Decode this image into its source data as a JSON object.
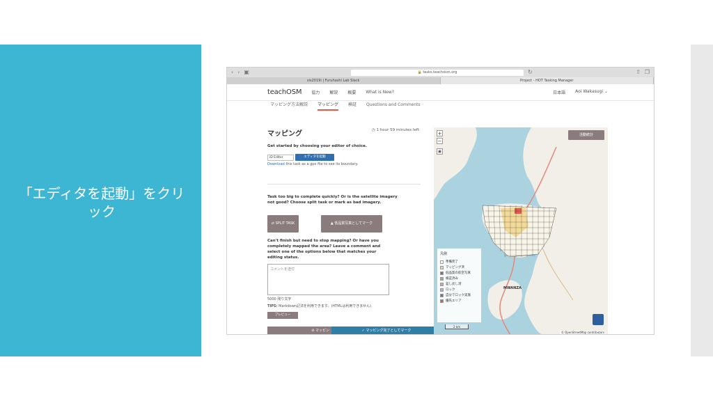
{
  "slide": {
    "caption": "「エディタを起動」をクリック",
    "colors": {
      "panel": "#3db6d4",
      "strip": "#e9e9e9"
    }
  },
  "browser": {
    "url": "tasks.teachosm.org",
    "tabs": [
      "sis2019i | Furuhashi Lab Slack",
      "Project - HOT Tasking Manager"
    ]
  },
  "app": {
    "logo": "teachOSM",
    "nav": [
      "協力",
      "解説",
      "概要",
      "What is New?"
    ],
    "language": "日本語",
    "user": "Aoi Wakasugi",
    "subnav": [
      "マッピング方法解説",
      "マッピング",
      "検証",
      "Questions and Comments"
    ],
    "active_subnav": "マッピング"
  },
  "panel": {
    "title": "マッピング",
    "timer": "1 hour 59 minutes left",
    "intro": "Get started by choosing your editor of choice.",
    "editor_select": "iD Editor",
    "launch_button": "エディタを起動",
    "download_link": "Download",
    "download_text": " this task as a gpx file to see its boundary.",
    "split_question": "Task too big to complete quickly? Or is the satellite imagery not good? Choose split task or mark as bad imagery.",
    "split_button": "SPLIT TASK",
    "bad_imagery_button": "低品質写真としてマーク",
    "stop_question": "Can't finish but need to stop mapping? Or have you completely mapped the area? Leave a comment and select one of the options below that matches your editing status.",
    "comment_placeholder": "コメントを送付",
    "char_limit": "5000 残り文字",
    "tips_label": "TIPS:",
    "tips_text": " Markdown記法を利用できます。(HTMLは利用できません)",
    "preview_button": "プレビュー",
    "stop_button": "マッピン",
    "done_button": "マッピング完了としてマーク"
  },
  "map": {
    "stats_button": "活動統計",
    "legend_title": "凡例",
    "legend": [
      {
        "label": "準備完了",
        "color": "#ffffff"
      },
      {
        "label": "マッピング済",
        "color": "#f2d58a"
      },
      {
        "label": "低品質の航空写真",
        "color": "#777777"
      },
      {
        "label": "検証済み",
        "color": "#7cc47c"
      },
      {
        "label": "差し戻し済",
        "color": "#f28fb8"
      },
      {
        "label": "ロック",
        "color": "#8fb8f2"
      },
      {
        "label": "自分でロック実施",
        "color": "#4a7fd0"
      },
      {
        "label": "優先エリア",
        "color": "#e35a4b"
      }
    ],
    "scale": "2 km",
    "attribution": "© OpenStreetMap contributors",
    "place": "MWANZA"
  }
}
